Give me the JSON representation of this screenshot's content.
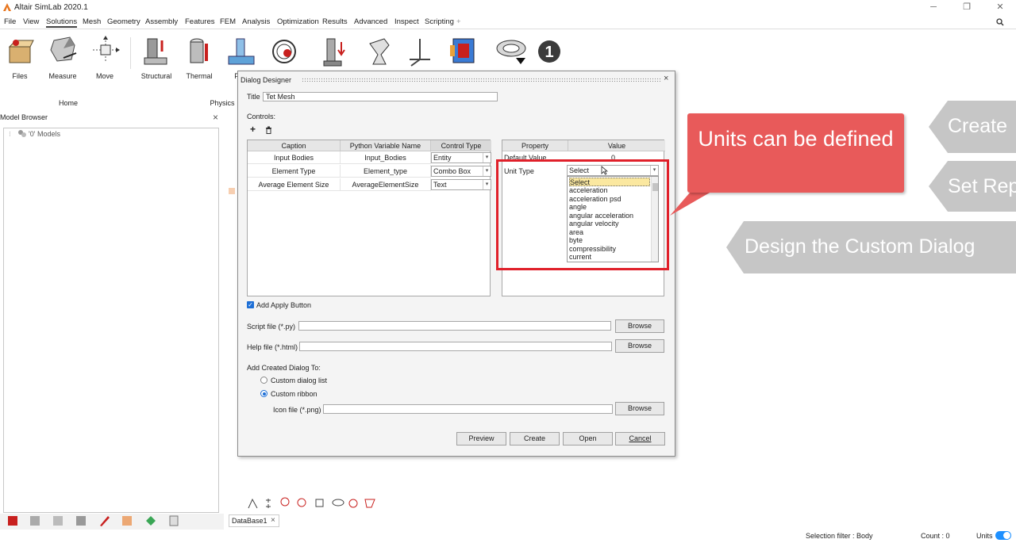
{
  "window": {
    "title": "Altair SimLab 2020.1",
    "minimize_icon": "minimize-icon",
    "restore_icon": "restore-icon",
    "close_icon": "close-icon"
  },
  "menu": {
    "items": [
      "File",
      "View",
      "Solutions",
      "Mesh",
      "Geometry",
      "Assembly",
      "Features",
      "FEM",
      "Analysis",
      "Optimization",
      "Results",
      "Advanced",
      "Inspect",
      "Scripting",
      "+"
    ],
    "active": "Solutions"
  },
  "ribbon": {
    "buttons": [
      "Files",
      "Measure",
      "Move",
      "Structural",
      "Thermal",
      "F"
    ],
    "groups": [
      "Home",
      "Physics"
    ]
  },
  "model_browser": {
    "title": "Model Browser",
    "close": "×",
    "tree_root": "'0' Models"
  },
  "dialog": {
    "title": "Dialog Designer",
    "close": "×",
    "title_label": "Title",
    "title_value": "Tet Mesh",
    "controls_label": "Controls:",
    "add": "+",
    "controls_table": {
      "headers": [
        "Caption",
        "Python Variable Name",
        "Control Type"
      ],
      "rows": [
        {
          "caption": "Input Bodies",
          "var": "Input_Bodies",
          "type": "Entity"
        },
        {
          "caption": "Element Type",
          "var": "Element_type",
          "type": "Combo Box"
        },
        {
          "caption": "Average Element Size",
          "var": "AverageElementSize",
          "type": "Text"
        }
      ]
    },
    "property_table": {
      "headers": [
        "Property",
        "Value"
      ],
      "rows": [
        {
          "property": "Default Value",
          "value": "0"
        },
        {
          "property": "Unit Type",
          "value": "Select"
        }
      ]
    },
    "unit_options": [
      "Select",
      "acceleration",
      "acceleration psd",
      "angle",
      "angular acceleration",
      "angular velocity",
      "area",
      "byte",
      "compressibility",
      "current"
    ],
    "add_apply_label": "Add Apply Button",
    "script_label": "Script file (*.py)",
    "help_label": "Help file (*.html)",
    "browse": "Browse",
    "add_created_label": "Add Created Dialog To:",
    "radio_dialog_list": "Custom dialog list",
    "radio_ribbon": "Custom ribbon",
    "icon_label": "Icon file (*.png)",
    "buttons": [
      "Preview",
      "Create",
      "Open",
      "Cancel"
    ]
  },
  "callout": {
    "text": "Units can be defined"
  },
  "slides": [
    "Create",
    "Set Rep",
    "Design the Custom Dialog"
  ],
  "tabs": {
    "database": "DataBase1",
    "database_close": "×"
  },
  "status": {
    "selection_filter": "Selection filter : Body",
    "count": "Count : 0",
    "units": "Units"
  },
  "colors": {
    "callout": "#e85a5a",
    "highlight_box": "#e0202a",
    "slide_arrow": "#c6c6c6",
    "toggle": "#1e90ff"
  }
}
